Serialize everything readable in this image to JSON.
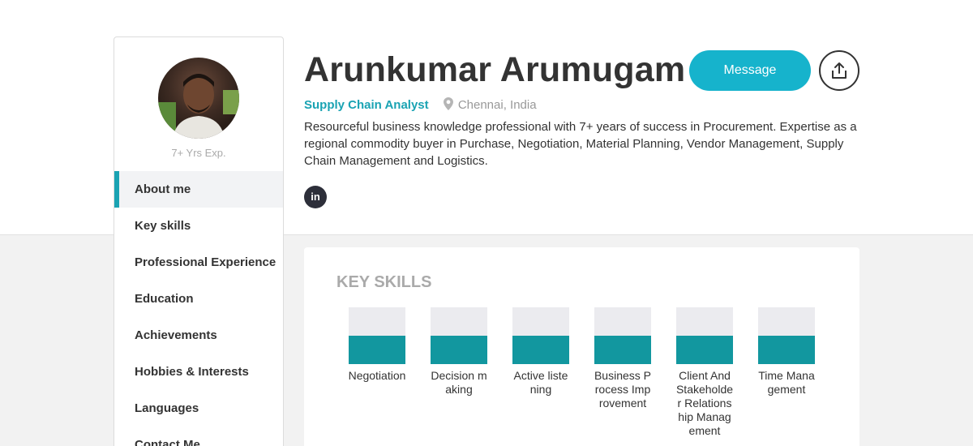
{
  "profile": {
    "name": "Arunkumar Arumugam",
    "role": "Supply Chain Analyst",
    "location": "Chennai, India",
    "experience": "7+ Yrs Exp.",
    "summary": "Resourceful business knowledge professional with 7+ years of success in Procurement. Expertise as a regional commodity buyer in Purchase, Negotiation, Material Planning, Vendor Management, Supply Chain Management and Logistics."
  },
  "actions": {
    "message_label": "Message",
    "share_icon": "share-icon",
    "linkedin_label": "in"
  },
  "sidebar": {
    "items": [
      {
        "label": "About me",
        "active": true
      },
      {
        "label": "Key skills"
      },
      {
        "label": "Professional Experience"
      },
      {
        "label": "Education"
      },
      {
        "label": "Achievements"
      },
      {
        "label": "Hobbies & Interests"
      },
      {
        "label": "Languages"
      },
      {
        "label": "Contact Me"
      }
    ]
  },
  "key_skills": {
    "title": "KEY SKILLS",
    "skills": [
      {
        "label": "Negotiation",
        "level": 0.5
      },
      {
        "label": "Decision making",
        "level": 0.5
      },
      {
        "label": "Active listening",
        "level": 0.5
      },
      {
        "label": "Business Process Improvement",
        "level": 0.5
      },
      {
        "label": "Client And Stakeholder Relationship Management",
        "level": 0.5
      },
      {
        "label": "Time Management",
        "level": 0.5
      }
    ]
  },
  "colors": {
    "accent": "#1aa3b3",
    "button": "#16b3cc",
    "skill_fill": "#12979f",
    "skill_track": "#ebebef"
  }
}
